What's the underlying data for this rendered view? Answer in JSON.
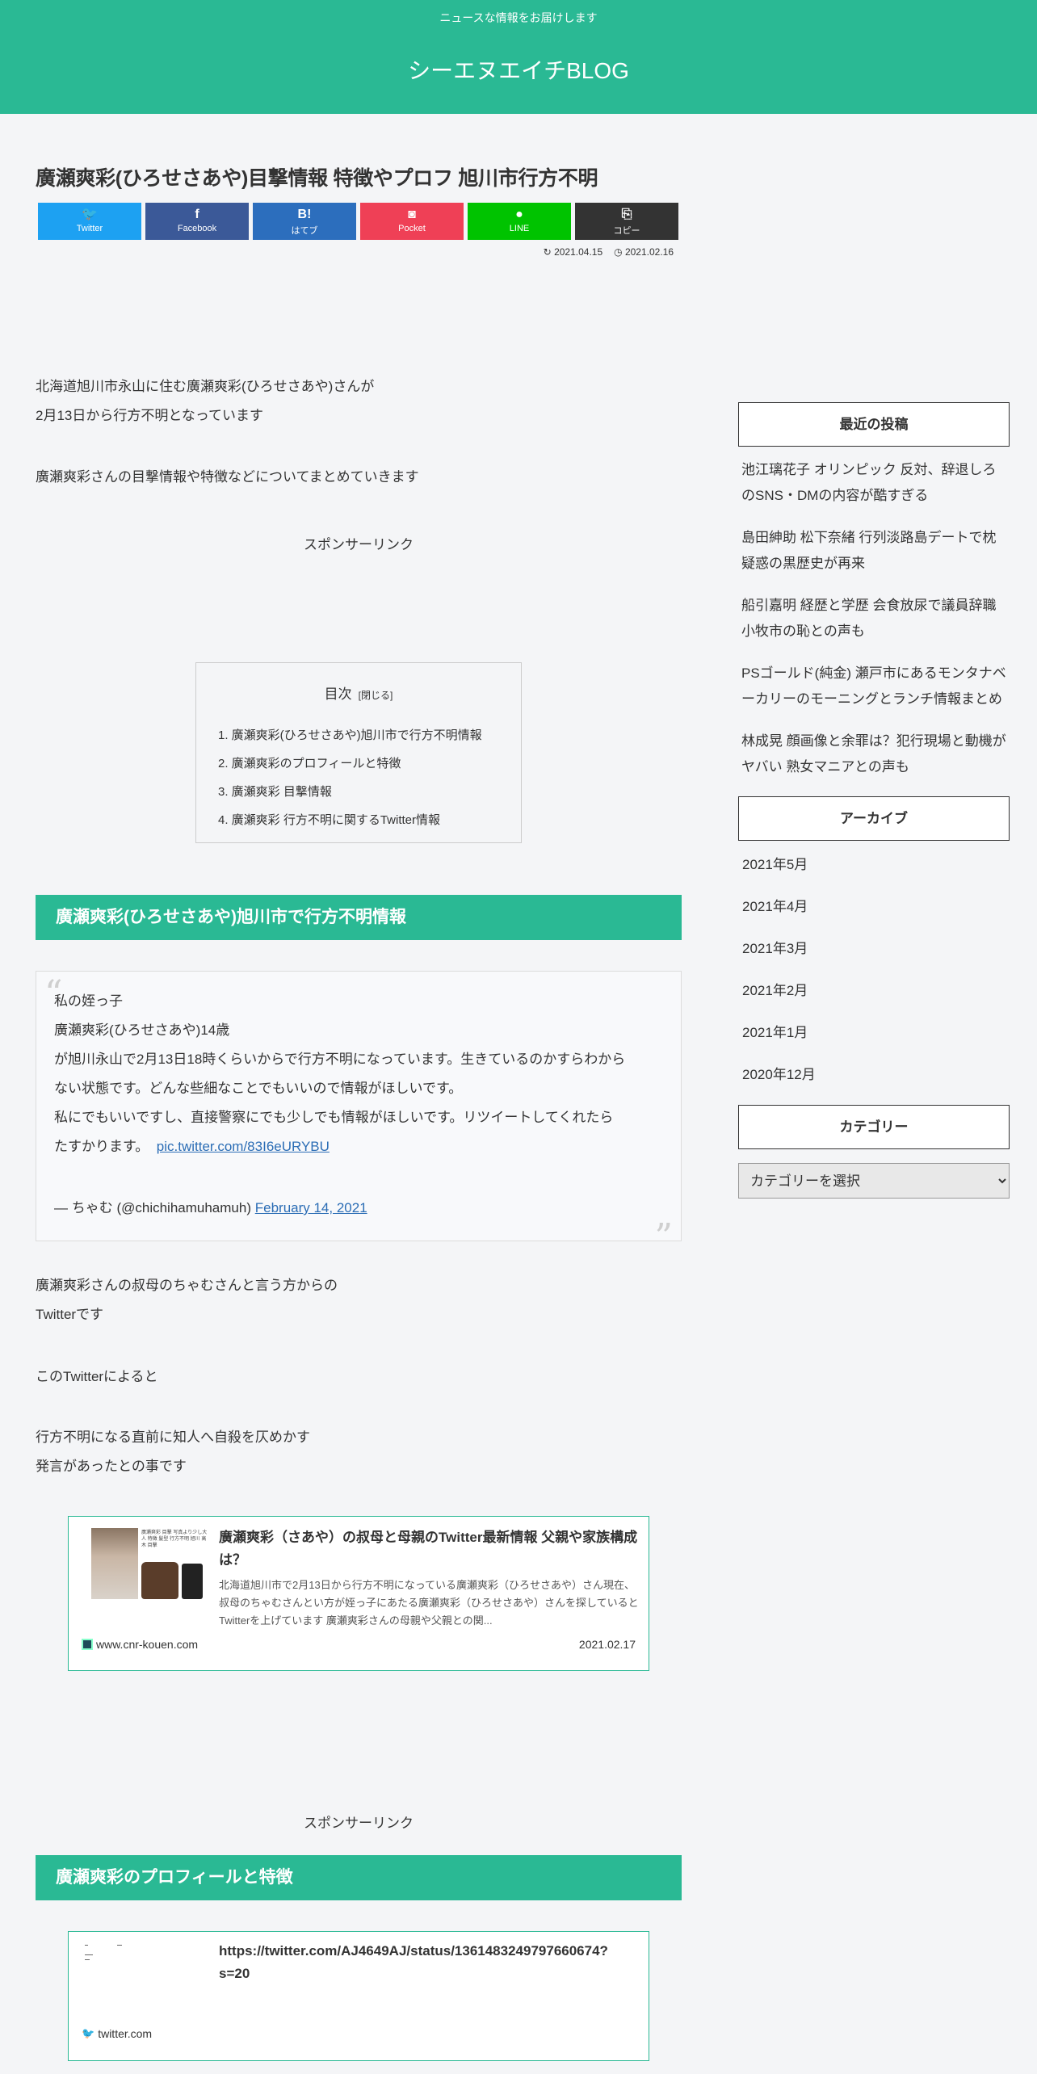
{
  "header": {
    "tagline": "ニュースな情報をお届けします",
    "site_title": "シーエヌエイチBLOG"
  },
  "post": {
    "title": "廣瀬爽彩(ひろせさあや)目撃情報 特徴やプロフ 旭川市行方不明",
    "share": [
      {
        "icon": "twitter-icon",
        "glyph": "🐦",
        "label": "Twitter"
      },
      {
        "icon": "facebook-icon",
        "glyph": "f",
        "label": "Facebook"
      },
      {
        "icon": "hatena-icon",
        "glyph": "B!",
        "label": "はてブ"
      },
      {
        "icon": "pocket-icon",
        "glyph": "◙",
        "label": "Pocket"
      },
      {
        "icon": "line-icon",
        "glyph": "●",
        "label": "LINE"
      },
      {
        "icon": "copy-icon",
        "glyph": "⎘",
        "label": "コピー"
      }
    ],
    "updated": "2021.04.15",
    "published": "2021.02.16",
    "intro_line1": "北海道旭川市永山に住む廣瀬爽彩(ひろせさあや)さんが",
    "intro_line2": "2月13日から行方不明となっています",
    "intro_line3": "廣瀬爽彩さんの目撃情報や特徴などについてまとめていきます",
    "sponsor_label": "スポンサーリンク"
  },
  "toc": {
    "title": "目次",
    "close_label": "[閉じる]",
    "items": [
      "1. 廣瀬爽彩(ひろせさあや)旭川市で行方不明情報",
      "2. 廣瀬爽彩のプロフィールと特徴",
      "3. 廣瀬爽彩 目撃情報",
      "4. 廣瀬爽彩 行方不明に関するTwitter情報"
    ]
  },
  "section1": {
    "heading": "廣瀬爽彩(ひろせさあや)旭川市で行方不明情報",
    "quote": {
      "line1": "私の姪っ子",
      "line2": "廣瀬爽彩(ひろせさあや)14歳",
      "line3": "が旭川永山で2月13日18時くらいからで行方不明になっています。生きているのかすらわから",
      "line4": "ない状態です。どんな些細なことでもいいので情報がほしいです。",
      "line5": "私にでもいいですし、直接警察にでも少しでも情報がほしいです。リツイートしてくれたら",
      "line6": "たすかります。",
      "link": "pic.twitter.com/83I6eURYBU",
      "attribution": "— ちゃむ (@chichihamuhamuh)",
      "date": "February 14, 2021"
    },
    "para1_line1": "廣瀬爽彩さんの叔母のちゃむさんと言う方からの",
    "para1_line2": "Twitterです",
    "para2": "このTwitterによると",
    "para3_line1": "行方不明になる直前に知人へ自殺を仄めかす",
    "para3_line2": "発言があったとの事です",
    "card": {
      "thumb_text": "廣瀬爽彩 目撃 写真より少し大人 特徴 髪型 行方不明 旭川 高木 目撃",
      "title": "廣瀬爽彩（さあや）の叔母と母親のTwitter最新情報 父親や家族構成は？",
      "snippet": "北海道旭川市で2月13日から行方不明になっている廣瀬爽彩（ひろせさあや）さん現在、叔母のちゃむさんとい方が姪っ子にあたる廣瀬爽彩（ひろせさあや）さんを探していると Twitterを上げています 廣瀬爽彩さんの母親や父親との関...",
      "site": "www.cnr-kouen.com",
      "date": "2021.02.17"
    }
  },
  "section2": {
    "heading": "廣瀬爽彩のプロフィールと特徴",
    "card": {
      "title": "https://twitter.com/AJ4649AJ/status/1361483249797660674?s=20",
      "site": "twitter.com"
    }
  },
  "sidebar": {
    "recent_title": "最近の投稿",
    "recent_posts": [
      "池江璃花子 オリンピック 反対、辞退しろのSNS・DMの内容が酷すぎる",
      "島田紳助 松下奈緒 行列淡路島デートで枕疑惑の黒歴史が再来",
      "船引嘉明 経歴と学歴 会食放尿で議員辞職 小牧市の恥との声も",
      "PSゴールド(純金) 瀬戸市にあるモンタナベーカリーのモーニングとランチ情報まとめ",
      "林成晃 顔画像と余罪は？犯行現場と動機がヤバい 熟女マニアとの声も"
    ],
    "archive_title": "アーカイブ",
    "archives": [
      "2021年5月",
      "2021年4月",
      "2021年3月",
      "2021年2月",
      "2021年1月",
      "2020年12月"
    ],
    "category_title": "カテゴリー",
    "category_select": "カテゴリーを選択"
  }
}
